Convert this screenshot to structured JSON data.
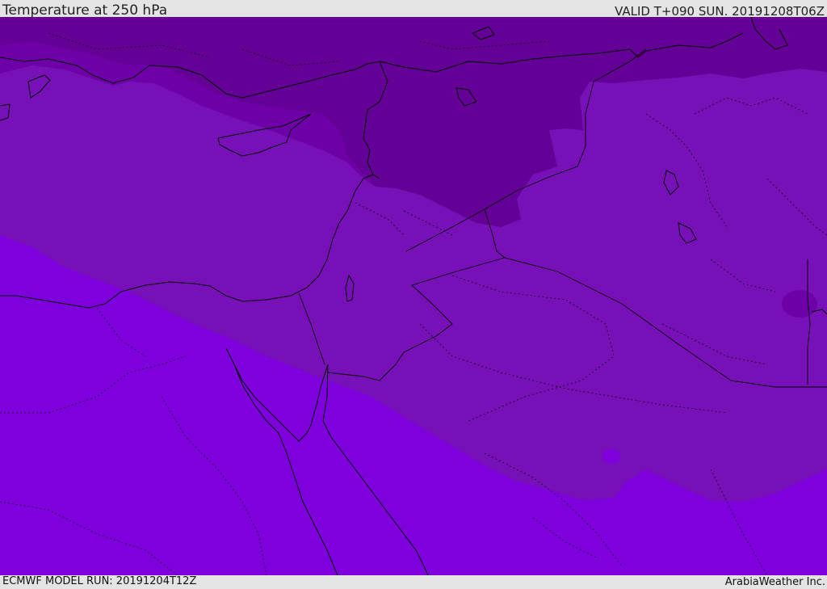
{
  "header": {
    "title": "Temperature at 250 hPa",
    "valid": "VALID T+090 SUN. 20191208T06Z"
  },
  "footer": {
    "model_run": "ECMWF MODEL RUN: 20191204T12Z",
    "credit": "ArabiaWeather Inc."
  },
  "map": {
    "colors": {
      "band_coldest": "#640096",
      "band_cold": "#6e00a8",
      "band_mid": "#7810b8",
      "band_warm": "#7e00dc",
      "coastline": "#000000"
    }
  }
}
